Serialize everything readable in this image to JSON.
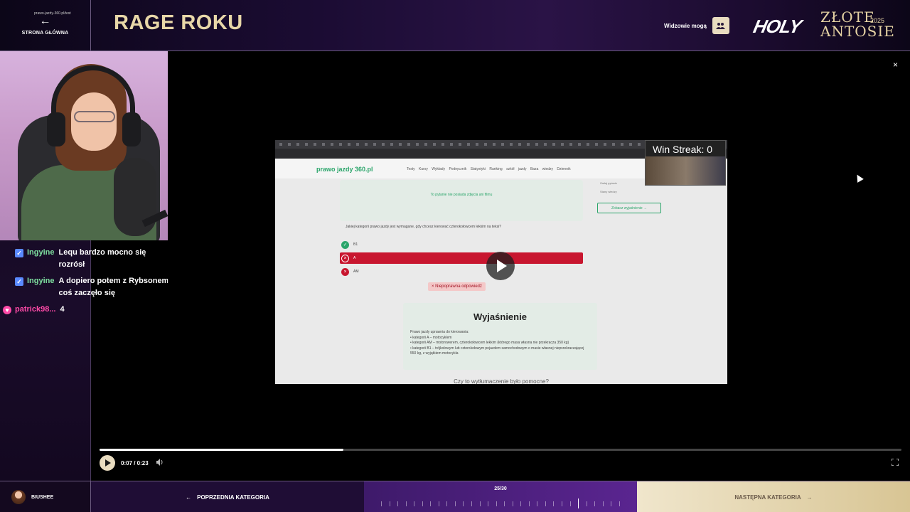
{
  "header": {
    "home_arrow": "←",
    "home_label": "STRONA GŁÓWNA",
    "title": "RAGE ROKU",
    "viewers_label": "Widzowie mogą",
    "viewers_icon": "users-icon",
    "logo_holy": "HOLY",
    "logo_line1": "ZŁOTE",
    "logo_line2": "ANTOSIE",
    "logo_year": "2025"
  },
  "chat": [
    {
      "user": "Ingyine",
      "message": "Lequ bardzo mocno się rozrósł",
      "badge": "moderator-icon",
      "user_color": "#7ee0a0"
    },
    {
      "user": "Ingyine",
      "message": "A dopiero potem z Rybsonem coś zaczęło się",
      "badge": "moderator-icon",
      "user_color": "#7ee0a0"
    },
    {
      "user": "patrick98...",
      "message": "4",
      "badge": "heart-icon",
      "user_color": "#ff4aa8"
    }
  ],
  "video": {
    "close": "×",
    "address": "prawo-jazdy-360.pl/test",
    "site_logo": "prawo jazdy 360.pl",
    "site_links": "Testy Kursy Wykłady Podręcznik Statystyki Ranking szkół jazdy Baza wiedzy Dziennik",
    "win_streak": "Win Streak: 0",
    "card_text": "To pytanie nie posiada zdjęcia ani filmu",
    "question": "Jakiej kategorii prawo jazdy jest wymagane, gdy chcesz kierować czterokołowcem lekkim na teksi?",
    "answers": [
      "B1",
      "A",
      "AM"
    ],
    "wrong_label": "Niepoprawna odpowiedź",
    "side_line1": "Zadaj pytanie",
    "side_line2": "Stany wiedzy",
    "side_button": "Zobacz wyjaśnienie →",
    "explanation_title": "Wyjaśnienie",
    "explanation_lines": [
      "Prawo jazdy uprawnia do kierowania:",
      "• kategorii A – motocyklem",
      "• kategorii AM – motorowerem, czterokołowcem lekkim (którego masa własna nie przekracza 350 kg)",
      "• kategorii B1 – trójkołowym lub czterokołowym pojazdem samochodowym o masie własnej nieprzekraczającej 550 kg, z wyjątkiem motocykla"
    ],
    "helpful": "Czy to wytłumaczenie było pomocne?"
  },
  "player": {
    "time": "0:07 / 0:23",
    "progress_fraction": 0.304,
    "volume_icon": "volume-icon",
    "fullscreen_icon": "fullscreen-icon"
  },
  "footer": {
    "user_name": "BIUSHEE",
    "prev_label": "POPRZEDNIA KATEGORIA",
    "counter": "25/30",
    "total": 30,
    "current": 25,
    "next_label": "NASTĘPNA KATEGORIA"
  },
  "colors": {
    "accent_gold": "#e8d7a8",
    "wrong_red": "#c8162f",
    "correct_green": "#2aa56a",
    "counter_purple": "#5a2590"
  }
}
